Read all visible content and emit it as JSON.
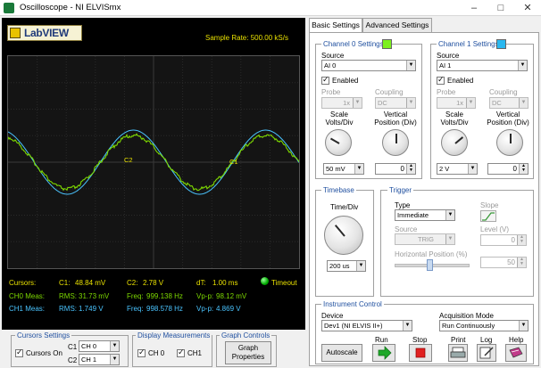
{
  "window": {
    "title": "Oscilloscope - NI ELVISmx"
  },
  "scope": {
    "logo": "LabVIEW",
    "sample_rate_label": "Sample Rate:",
    "sample_rate_value": "500.00 kS/s",
    "cursor_labels": {
      "c1": "C1",
      "c2": "C2"
    },
    "readouts": {
      "cursors_label": "Cursors:",
      "c1_label": "C1:",
      "c1_value": "48.84 mV",
      "c2_label": "C2:",
      "c2_value": "2.78 V",
      "dt_label": "dT:",
      "dt_value": "1.00 ms",
      "timeout_label": "Timeout",
      "ch0_label": "CH0 Meas:",
      "ch0_rms_label": "RMS:",
      "ch0_rms": "31.73 mV",
      "ch0_freq_label": "Freq:",
      "ch0_freq": "999.138 Hz",
      "ch0_vpp_label": "Vp-p:",
      "ch0_vpp": "98.12 mV",
      "ch1_label": "CH1 Meas:",
      "ch1_rms_label": "RMS:",
      "ch1_rms": "1.749 V",
      "ch1_freq_label": "Freq:",
      "ch1_freq": "998.578 Hz",
      "ch1_vpp_label": "Vp-p:",
      "ch1_vpp": "4.869 V"
    },
    "colors": {
      "ch0": "#7dd800",
      "ch1": "#4ac4ff",
      "text": "#e8e000",
      "grid": "#2a2a2a"
    }
  },
  "cursors_settings": {
    "title": "Cursors Settings",
    "cursors_on_label": "Cursors On",
    "cursors_on": true,
    "c1_label": "C1",
    "c1_value": "CH 0",
    "c2_label": "C2",
    "c2_value": "CH 1"
  },
  "display_measurements": {
    "title": "Display Measurements",
    "ch0_label": "CH 0",
    "ch0_checked": true,
    "ch1_label": "CH1",
    "ch1_checked": true
  },
  "graph_controls": {
    "title": "Graph Controls",
    "button_line1": "Graph",
    "button_line2": "Properties"
  },
  "tabs": {
    "basic": "Basic Settings",
    "advanced": "Advanced Settings"
  },
  "channel0": {
    "title": "Channel 0 Settings",
    "color": "#7cf01e",
    "source_label": "Source",
    "source_value": "AI 0",
    "enabled_label": "Enabled",
    "probe_label": "Probe",
    "probe_value": "1x",
    "coupling_label": "Coupling",
    "coupling_value": "DC",
    "scale_label_1": "Scale",
    "scale_label_2": "Volts/Div",
    "vpos_label_1": "Vertical",
    "vpos_label_2": "Position (Div)",
    "scale_value": "50 mV",
    "vpos_value": "0"
  },
  "channel1": {
    "title": "Channel 1 Settings",
    "color": "#2ab8f0",
    "source_label": "Source",
    "source_value": "AI 1",
    "enabled_label": "Enabled",
    "probe_label": "Probe",
    "probe_value": "1x",
    "coupling_label": "Coupling",
    "coupling_value": "DC",
    "scale_label_1": "Scale",
    "scale_label_2": "Volts/Div",
    "vpos_label_1": "Vertical",
    "vpos_label_2": "Position (Div)",
    "scale_value": "2 V",
    "vpos_value": "0"
  },
  "timebase": {
    "title": "Timebase",
    "time_div_label": "Time/Div",
    "value": "200 us"
  },
  "trigger": {
    "title": "Trigger",
    "type_label": "Type",
    "type_value": "Immediate",
    "slope_label": "Slope",
    "source_label": "Source",
    "source_value": "TRIG",
    "level_label": "Level (V)",
    "level_value": "0",
    "hpos_label": "Horizontal Position (%)",
    "hpos_value": "50"
  },
  "instrument_control": {
    "title": "Instrument Control",
    "device_label": "Device",
    "device_value": "Dev1 (NI ELVIS II+)",
    "acq_label": "Acquisition Mode",
    "acq_value": "Run Continuously",
    "autoscale": "Autoscale",
    "run_label": "Run",
    "stop_label": "Stop",
    "print_label": "Print",
    "log_label": "Log",
    "help_label": "Help"
  }
}
